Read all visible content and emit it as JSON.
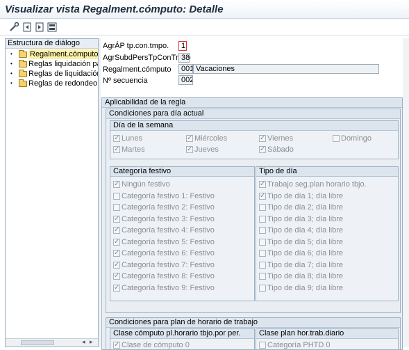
{
  "window": {
    "title": "Visualizar vista Regalment.cómputo: Detalle"
  },
  "toolbar": {
    "buttons": [
      {
        "icon": "edit-glasses-icon"
      },
      {
        "icon": "previous-entry-icon"
      },
      {
        "icon": "next-entry-icon"
      },
      {
        "icon": "other-entry-icon"
      }
    ]
  },
  "dialog_structure": {
    "header": "Estructura de diálogo",
    "items": [
      {
        "label": "Regalment.cómputo",
        "selected": true
      },
      {
        "label": "Reglas liquidación para co",
        "selected": false
      },
      {
        "label": "Reglas de liquidación par",
        "selected": false
      },
      {
        "label": "Reglas de redondeo",
        "selected": false
      }
    ]
  },
  "fields": {
    "agr_label": "AgrÁP tp.con.tmpo.",
    "agr_value": "1",
    "agrsubd_label": "AgrSubdPersTpConTmpo",
    "agrsubd_value": "38",
    "regla_label": "Regalment.cómputo",
    "regla_code": "001",
    "regla_text": "Vacaciones",
    "seq_label": "Nº secuencia",
    "seq_value": "002"
  },
  "applicability": {
    "title": "Aplicabilidad de la regla",
    "current_day": {
      "title": "Condiciones para día actual",
      "weekday": {
        "title": "Día de la semana",
        "days": [
          {
            "label": "Lunes",
            "checked": true
          },
          {
            "label": "Miércoles",
            "checked": true
          },
          {
            "label": "Viernes",
            "checked": true
          },
          {
            "label": "Domingo",
            "checked": false
          },
          {
            "label": "Martes",
            "checked": true
          },
          {
            "label": "Jueves",
            "checked": true
          },
          {
            "label": "Sábado",
            "checked": true
          }
        ]
      },
      "holiday": {
        "title": "Categoría festivo",
        "items": [
          {
            "label": "Ningún festivo",
            "checked": true
          },
          {
            "label": "Categoría festivo 1: Festivo",
            "checked": false
          },
          {
            "label": "Categoría festivo 2: Festivo",
            "checked": false
          },
          {
            "label": "Categoría festivo 3: Festivo",
            "checked": true
          },
          {
            "label": "Categoría festivo 4: Festivo",
            "checked": true
          },
          {
            "label": "Categoría festivo 5: Festivo",
            "checked": true
          },
          {
            "label": "Categoría festivo 6: Festivo",
            "checked": true
          },
          {
            "label": "Categoría festivo 7: Festivo",
            "checked": true
          },
          {
            "label": "Categoría festivo 8: Festivo",
            "checked": true
          },
          {
            "label": "Categoría festivo 9: Festivo",
            "checked": true
          }
        ]
      },
      "daytype": {
        "title": "Tipo de día",
        "items": [
          {
            "label": "Trabajo seg.plan horario tbjo.",
            "checked": true
          },
          {
            "label": "Tipo de día 1; día libre",
            "checked": true
          },
          {
            "label": "Tipo de día 2; día libre",
            "checked": false
          },
          {
            "label": "Tipo de día 3; día libre",
            "checked": false
          },
          {
            "label": "Tipo de día 4; día libre",
            "checked": false
          },
          {
            "label": "Tipo de día 5; día libre",
            "checked": false
          },
          {
            "label": "Tipo de día 6; día libre",
            "checked": false
          },
          {
            "label": "Tipo de día 7; día libre",
            "checked": false
          },
          {
            "label": "Tipo de día 8; día libre",
            "checked": false
          },
          {
            "label": "Tipo de día 9; día libre",
            "checked": false
          }
        ]
      }
    },
    "work_schedule": {
      "title": "Condiciones para plan de horario de trabajo",
      "period_class": {
        "title": "Clase cómputo pl.horario tbjo.por per.",
        "first_item": "Clase de cómputo 0",
        "first_checked": true
      },
      "daily_class": {
        "title": "Clase plan hor.trab.diario",
        "first_item": "Categoría PHTD 0",
        "first_checked": false
      }
    }
  }
}
